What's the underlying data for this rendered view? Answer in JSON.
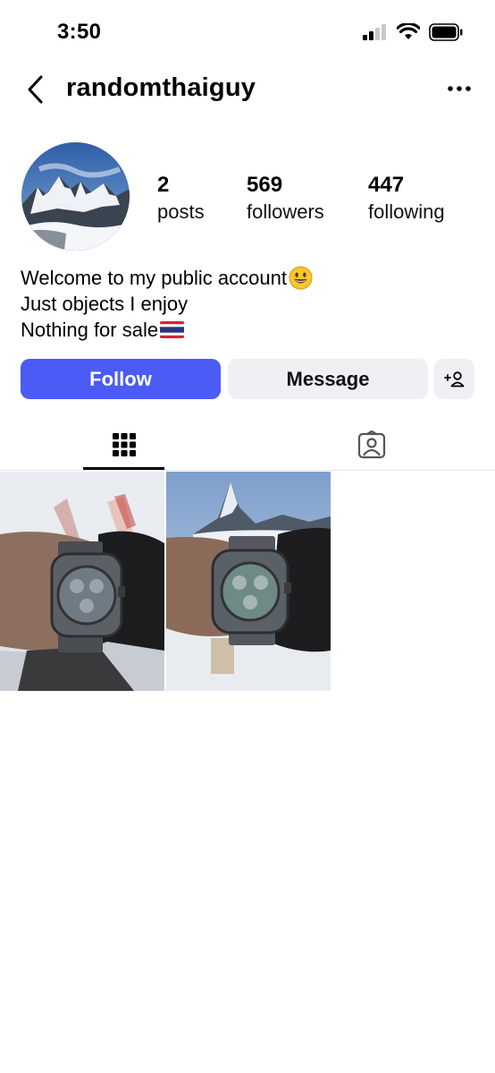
{
  "status_bar": {
    "time": "3:50",
    "icons": [
      "cellular-signal-icon",
      "wifi-icon",
      "battery-icon"
    ]
  },
  "header": {
    "username": "randomthaiguy",
    "back_icon": "chevron-left-icon",
    "more_icon": "more-horizontal-icon"
  },
  "profile": {
    "stats": {
      "posts": {
        "count": "2",
        "label": "posts"
      },
      "followers": {
        "count": "569",
        "label": "followers"
      },
      "following": {
        "count": "447",
        "label": "following"
      }
    },
    "bio": {
      "line1": "Welcome to my public account",
      "line1_emoji": "smiling-face-emoji",
      "line2": "Just objects I enjoy",
      "line3": "Nothing for sale",
      "line3_emoji": "thailand-flag-emoji"
    }
  },
  "actions": {
    "follow_label": "Follow",
    "message_label": "Message",
    "add_person_icon": "add-person-icon"
  },
  "tabs": [
    {
      "name": "posts-grid",
      "icon": "grid-icon",
      "active": true
    },
    {
      "name": "tagged",
      "icon": "tagged-person-icon",
      "active": false
    }
  ],
  "colors": {
    "follow_button": "#4a5cf5",
    "secondary_button": "#eff0f3"
  }
}
